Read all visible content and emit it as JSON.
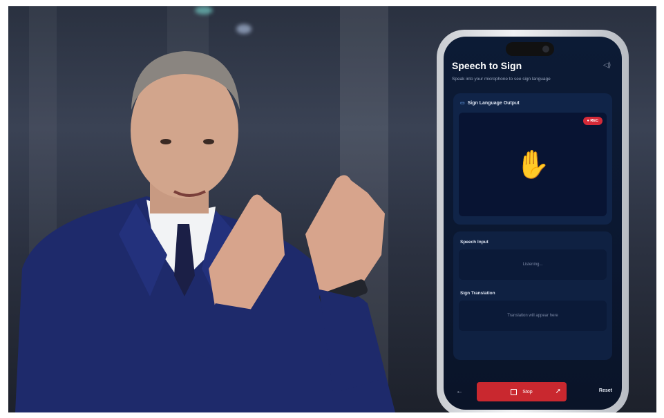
{
  "app": {
    "title": "Speech to Sign",
    "subtitle": "Speak into your microphone to see sign language"
  },
  "output": {
    "label": "Sign Language Output",
    "rec_badge": "● REC"
  },
  "speech_input": {
    "label": "Speech Input",
    "status": "Listening..."
  },
  "sign_translation": {
    "label": "Sign Translation",
    "placeholder": "Translation will appear here"
  },
  "controls": {
    "back": "←",
    "stop": "Stop",
    "reset": "Reset"
  },
  "icons": {
    "volume": "volume-icon",
    "camera": "camera-icon",
    "hand": "raised-hand-icon"
  },
  "colors": {
    "accent_red": "#c9282f",
    "screen_bg": "#0c1b35"
  }
}
